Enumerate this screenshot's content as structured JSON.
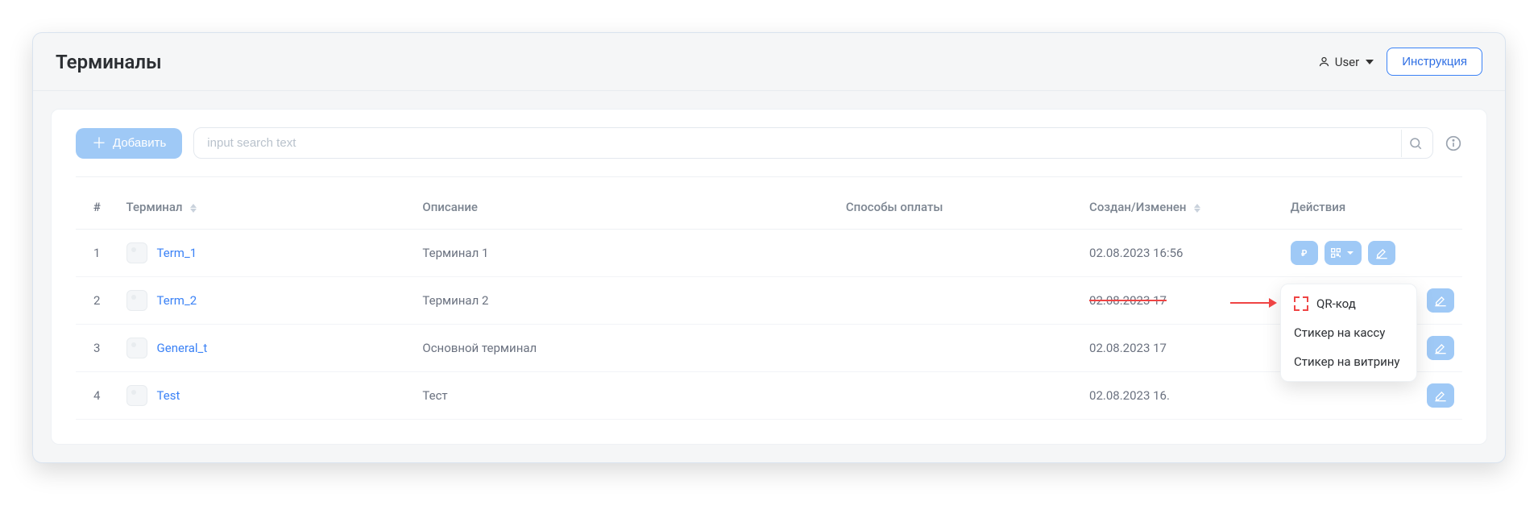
{
  "header": {
    "title": "Терминалы",
    "user_label": "User",
    "instructions_label": "Инструкция"
  },
  "toolbar": {
    "add_label": "Добавить",
    "search_placeholder": "input search text"
  },
  "table": {
    "columns": {
      "num": "#",
      "terminal": "Терминал",
      "description": "Описание",
      "payment_methods": "Способы оплаты",
      "created_modified": "Создан/Изменен",
      "actions": "Действия"
    },
    "rows": [
      {
        "num": "1",
        "name": "Term_1",
        "description": "Терминал 1",
        "payment_methods": "",
        "date": "02.08.2023 16:56",
        "dropdown_open": false,
        "show_actions": true
      },
      {
        "num": "2",
        "name": "Term_2",
        "description": "Терминал 2",
        "payment_methods": "",
        "date": "02.08.2023 17",
        "dropdown_open": true,
        "show_actions": false,
        "date_strike": true
      },
      {
        "num": "3",
        "name": "General_t",
        "description": "Основной терминал",
        "payment_methods": "",
        "date": "02.08.2023 17",
        "dropdown_open": false,
        "show_actions": false
      },
      {
        "num": "4",
        "name": "Test",
        "description": "Тест",
        "payment_methods": "",
        "date": "02.08.2023 16.",
        "dropdown_open": false,
        "show_actions": false
      }
    ]
  },
  "dropdown": {
    "items": [
      "QR-код",
      "Стикер на кассу",
      "Стикер на витрину"
    ]
  }
}
